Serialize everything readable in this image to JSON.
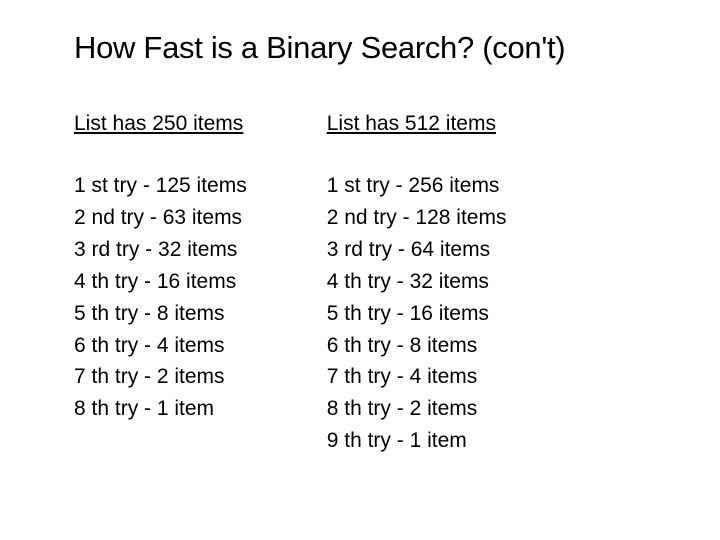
{
  "title": "How Fast is a Binary Search? (con't)",
  "left": {
    "header": "List has 250 items",
    "tries": [
      "1 st try - 125 items",
      "2 nd try - 63 items",
      "3 rd try - 32 items",
      "4 th try - 16 items",
      "5 th try - 8 items",
      "6 th try - 4 items",
      "7 th try - 2 items",
      "8 th try - 1 item"
    ]
  },
  "right": {
    "header": "List has 512 items",
    "tries": [
      "1 st try - 256 items",
      "2 nd try - 128 items",
      "3 rd try - 64 items",
      "4 th try - 32 items",
      "5 th try - 16 items",
      "6 th try - 8 items",
      "7 th try - 4 items",
      "8 th try - 2 items",
      "9 th try - 1 item"
    ]
  }
}
